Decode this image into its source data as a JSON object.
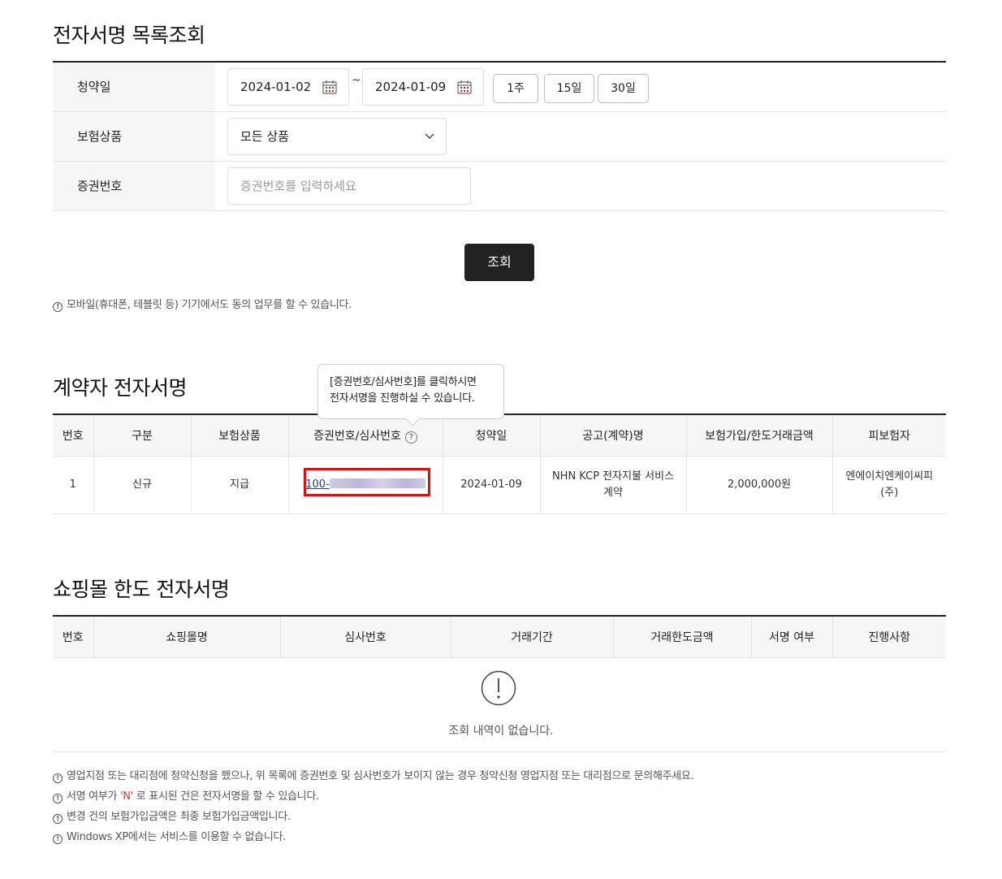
{
  "search": {
    "title": "전자서명 목록조회",
    "date_label": "청약일",
    "date_from": "2024-01-02",
    "date_sep": "~",
    "date_to": "2024-01-09",
    "period_buttons": [
      "1주",
      "15일",
      "30일"
    ],
    "product_label": "보험상품",
    "product_selected": "모든 상품",
    "cert_label": "증권번호",
    "cert_placeholder": "증권번호를 입력하세요",
    "submit_label": "조회",
    "notice": "모바일(휴대폰, 테블릿 등) 기기에서도 동의 업무를 할 수 있습니다."
  },
  "contract": {
    "title": "계약자 전자서명",
    "tooltip_line1": "[증권번호/심사번호]를 클릭하시면",
    "tooltip_line2": "전자서명을 진행하실 수 있습니다.",
    "columns": [
      "번호",
      "구분",
      "보험상품",
      "증권번호/심사번호",
      "청약일",
      "공고(계약)명",
      "보험가입/한도거래금액",
      "피보험자"
    ],
    "rows": [
      {
        "no": "1",
        "type": "신규",
        "product": "지급",
        "cert_prefix": "100-",
        "date": "2024-01-09",
        "contract_name": "NHN KCP 전자지불 서비스 계약",
        "amount": "2,000,000원",
        "insured": "엔에이치엔케이씨피(주)"
      }
    ]
  },
  "shop": {
    "title": "쇼핑몰 한도 전자서명",
    "columns": [
      "번호",
      "쇼핑몰명",
      "심사번호",
      "거래기간",
      "거래한도금액",
      "서명 여부",
      "진행사항"
    ],
    "empty_text": "조회 내역이 없습니다."
  },
  "notes": {
    "n1": "영업지점 또는 대리점에 청약신청을 했으나, 위 목록에 증권번호 및 심사번호가 보이지 않는 경우 청약신청 영업지점 또는 대리점으로 문의해주세요.",
    "n2_pre": "서명 여부가 ",
    "n2_red": "'N'",
    "n2_post": " 로 표시된 건은 전자서명을 할 수 있습니다.",
    "n3": "변경 건의 보험가입금액은 최종 보험가입금액입니다.",
    "n4": "Windows XP에서는 서비스를 이용할 수 없습니다."
  },
  "colors": {
    "accent_dark": "#222222",
    "highlight": "#e20d0d",
    "link": "#1f3a8a",
    "red_text": "#e8322b"
  },
  "icons": [
    "calendar-icon",
    "chevron-down-icon",
    "info-icon",
    "question-icon",
    "exclamation-circle-icon"
  ]
}
